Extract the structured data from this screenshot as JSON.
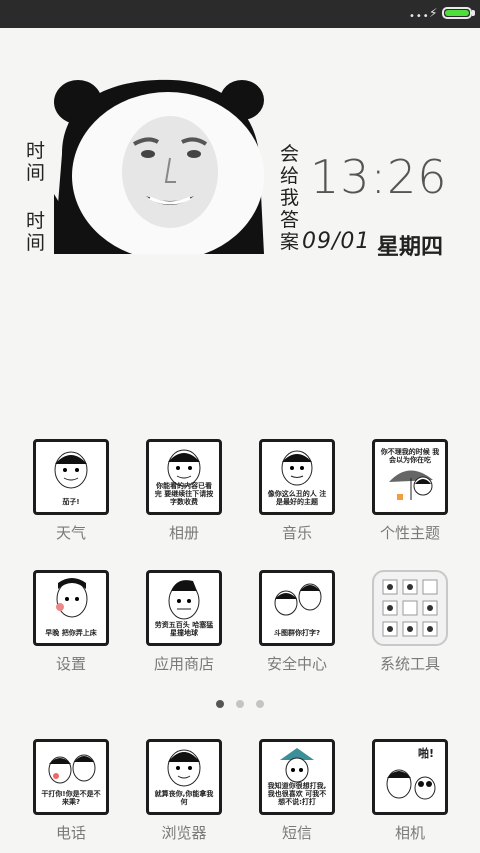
{
  "status_bar": {
    "signal_dots": "•••"
  },
  "widget": {
    "left_text_1": "时间",
    "left_text_2": "时间",
    "right_text": "会给我答案",
    "time": "13:26",
    "date": "09/01",
    "weekday": "星期四"
  },
  "apps": [
    {
      "label": "天气",
      "caption": "茄子!"
    },
    {
      "label": "相册",
      "caption": "你能看的内容已看完 要继续往下请按字数收费"
    },
    {
      "label": "音乐",
      "caption": "像你这么丑的人 注是最好的主题"
    },
    {
      "label": "个性主题",
      "caption": "你不理我的时候 我会以为你在吃"
    },
    {
      "label": "设置",
      "caption": "早晚 把你弄上床"
    },
    {
      "label": "应用商店",
      "caption": "劳资五百头 哈塞猛星撞地球"
    },
    {
      "label": "安全中心",
      "caption": "斗图群你打字?"
    },
    {
      "label": "系统工具",
      "caption": ""
    }
  ],
  "dock": [
    {
      "label": "电话",
      "caption": "干打你!你是不是不来乘?"
    },
    {
      "label": "浏览器",
      "caption": "就算丧你,你能拿我何"
    },
    {
      "label": "短信",
      "caption": "我知道你很想打我,我也很喜欢 可我不想不说:打打"
    },
    {
      "label": "相机",
      "caption": "啪!"
    }
  ],
  "pager": {
    "pages": 3,
    "current": 1
  }
}
